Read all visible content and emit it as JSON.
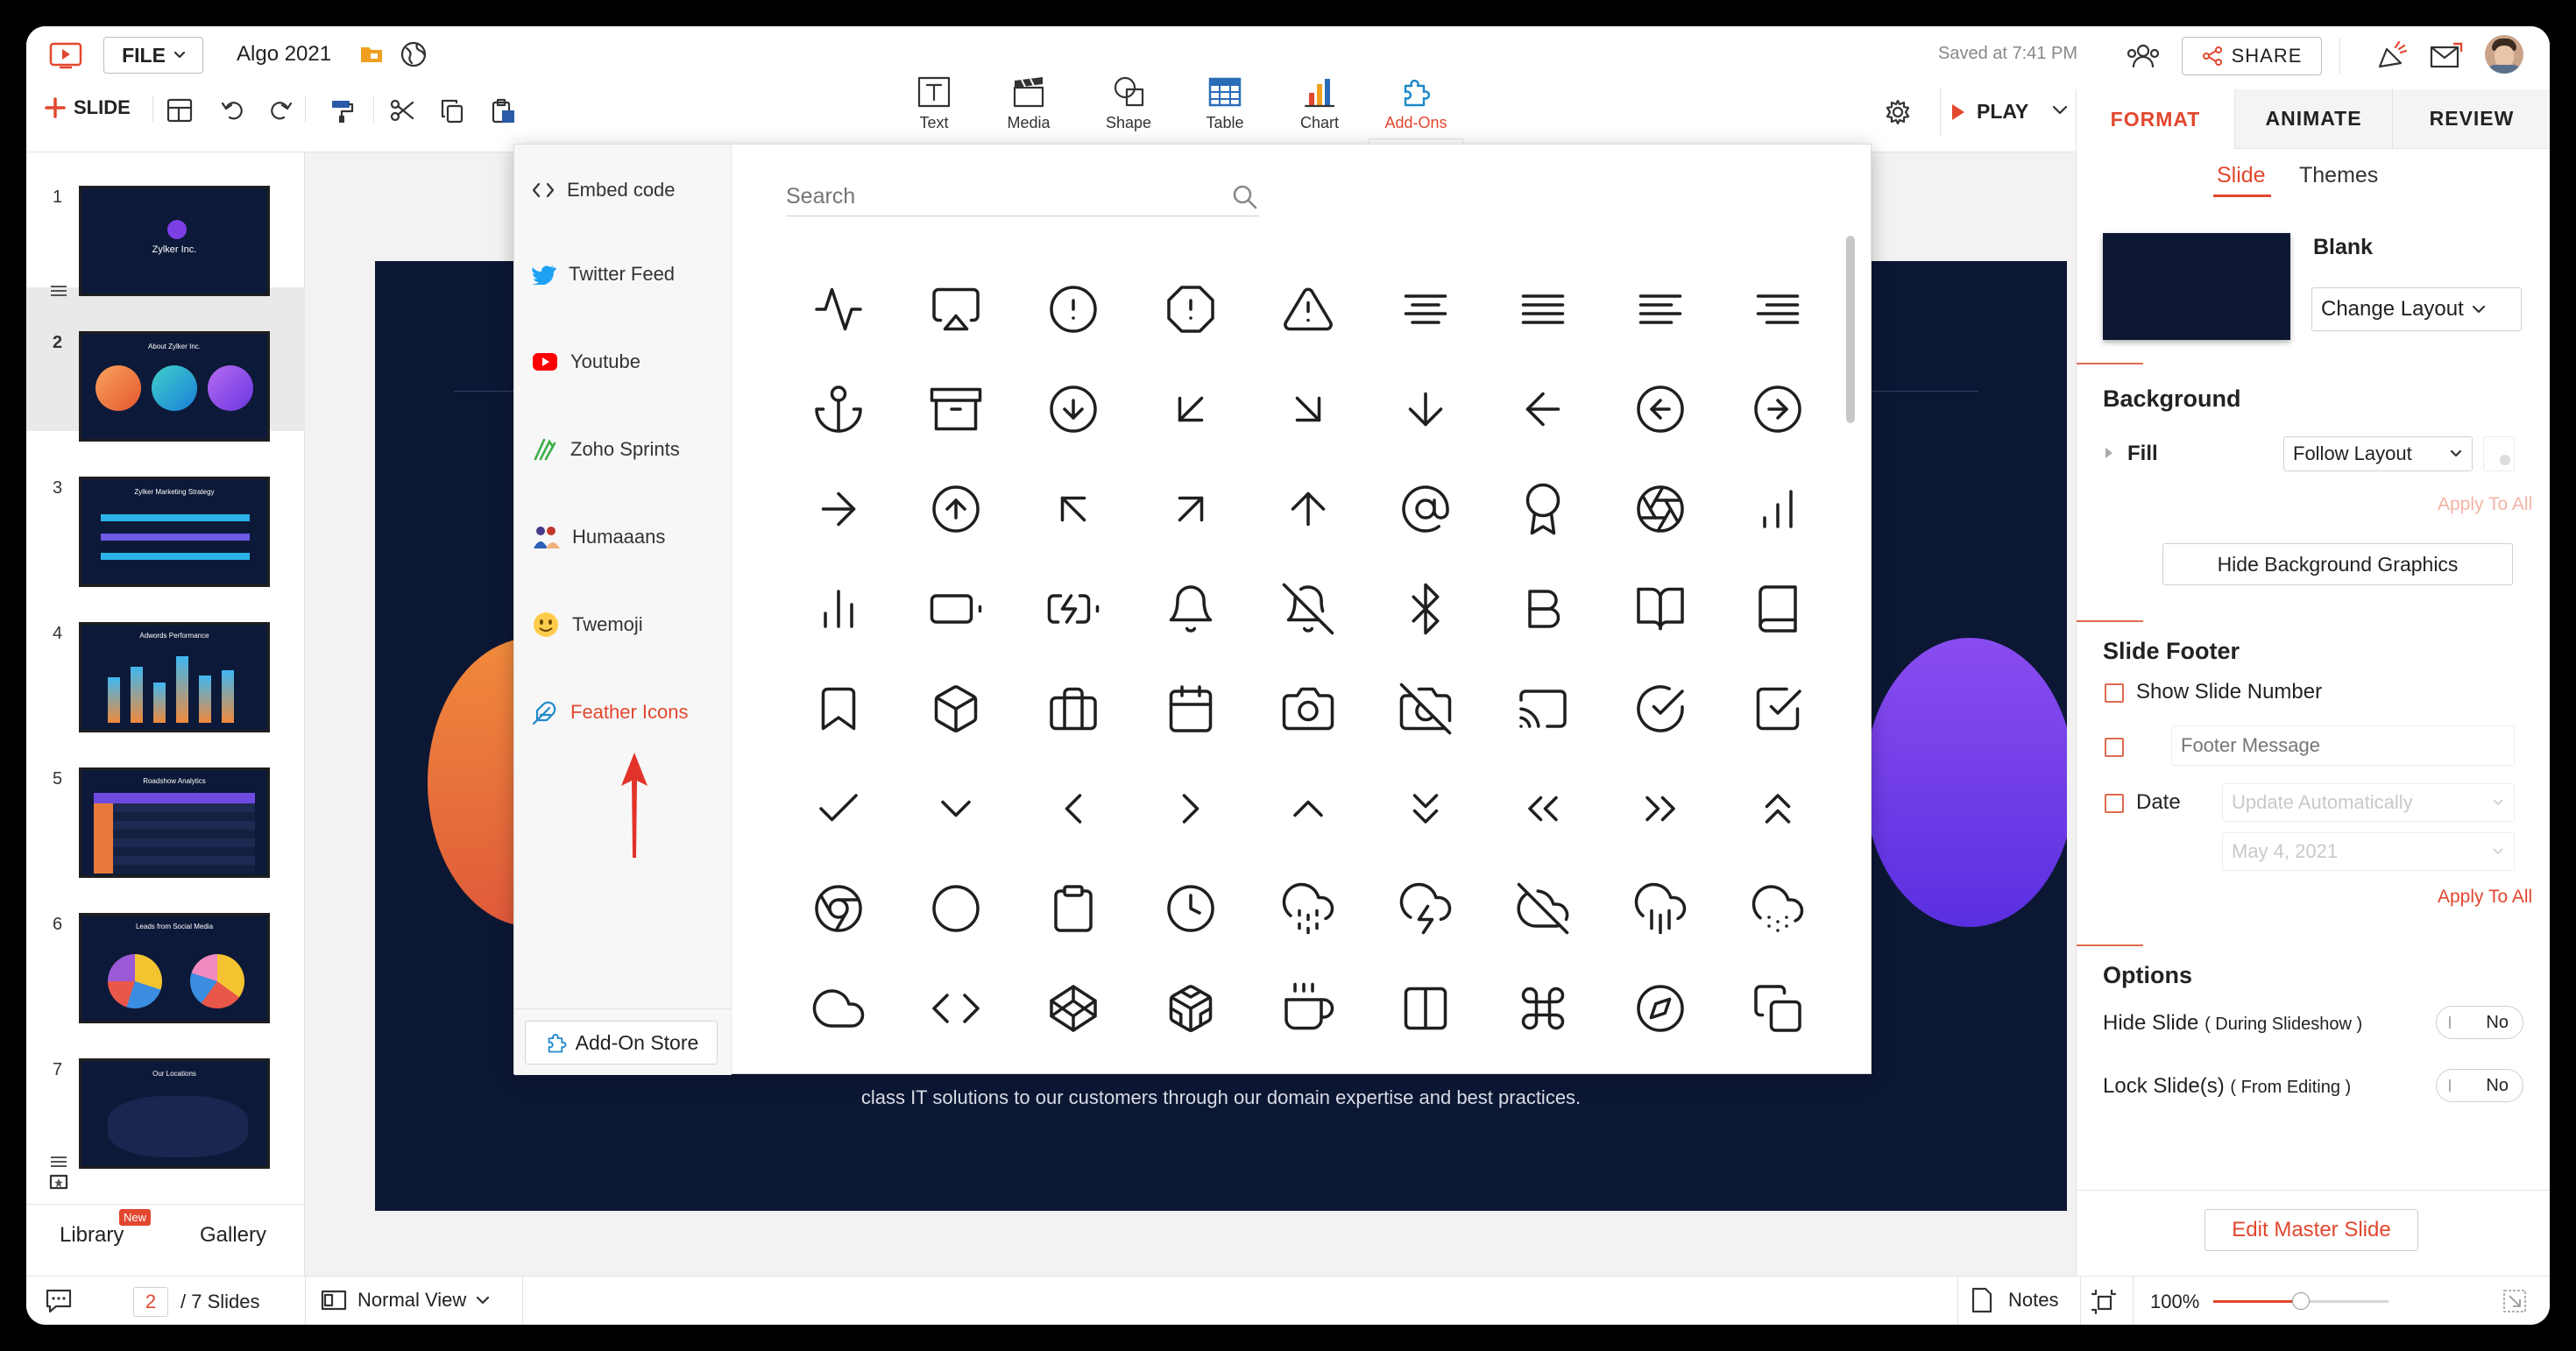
{
  "document": {
    "title": "Algo 2021",
    "saved_status": "Saved at 7:41 PM"
  },
  "toolbar": {
    "file_label": "FILE",
    "slide_label": "SLIDE",
    "share_label": "SHARE",
    "play_label": "PLAY",
    "insert_items": [
      {
        "label": "Text",
        "icon": "text-box-icon"
      },
      {
        "label": "Media",
        "icon": "clapper-icon"
      },
      {
        "label": "Shape",
        "icon": "shape-icon"
      },
      {
        "label": "Table",
        "icon": "table-icon"
      },
      {
        "label": "Chart",
        "icon": "bar-chart-icon"
      },
      {
        "label": "Add-Ons",
        "icon": "puzzle-icon",
        "active": true
      }
    ]
  },
  "right_panel": {
    "tabs": [
      "FORMAT",
      "ANIMATE",
      "REVIEW"
    ],
    "active_tab": "FORMAT",
    "subtabs": [
      "Slide",
      "Themes"
    ],
    "active_subtab": "Slide",
    "layout_name": "Blank",
    "change_layout_label": "Change Layout",
    "background": {
      "title": "Background",
      "fill_label": "Fill",
      "fill_value": "Follow Layout",
      "apply_all_label": "Apply To All",
      "hide_bg_label": "Hide Background Graphics"
    },
    "footer": {
      "title": "Slide Footer",
      "show_number_label": "Show Slide Number",
      "footer_message_placeholder": "Footer Message",
      "date_label": "Date",
      "date_mode": "Update Automatically",
      "date_value": "May 4, 2021",
      "apply_all_label": "Apply To All"
    },
    "options": {
      "title": "Options",
      "hide_slide_label": "Hide Slide",
      "hide_slide_note": "( During Slideshow )",
      "hide_slide_value": "No",
      "lock_slide_label": "Lock Slide(s)",
      "lock_slide_note": "( From Editing )",
      "lock_slide_value": "No"
    },
    "edit_master_label": "Edit Master Slide"
  },
  "slides_panel": {
    "slides": [
      {
        "number": "1",
        "title": "Zylker Inc."
      },
      {
        "number": "2",
        "title": "About Zylker Inc."
      },
      {
        "number": "3",
        "title": "Zylker Marketing Strategy"
      },
      {
        "number": "4",
        "title": "Adwords Performance"
      },
      {
        "number": "5",
        "title": "Roadshow Analytics"
      },
      {
        "number": "6",
        "title": "Leads from Social Media"
      },
      {
        "number": "7",
        "title": "Our Locations"
      }
    ],
    "selected": 2,
    "library_label": "Library",
    "library_badge": "New",
    "gallery_label": "Gallery"
  },
  "canvas": {
    "body_text": "class IT solutions to our customers through our domain expertise and best practices."
  },
  "addons_popup": {
    "menu": [
      {
        "label": "Embed code",
        "icon": "code-icon"
      },
      {
        "label": "Twitter Feed",
        "icon": "twitter-icon"
      },
      {
        "label": "Youtube",
        "icon": "youtube-icon"
      },
      {
        "label": "Zoho Sprints",
        "icon": "sprints-icon"
      },
      {
        "label": "Humaaans",
        "icon": "humaaans-icon"
      },
      {
        "label": "Twemoji",
        "icon": "emoji-icon"
      },
      {
        "label": "Feather Icons",
        "icon": "feather-icon",
        "active": true
      }
    ],
    "store_label": "Add-On Store",
    "search_placeholder": "Search",
    "icons": [
      "activity",
      "airplay",
      "alert-circle",
      "alert-octagon",
      "alert-triangle",
      "align-center",
      "align-justify",
      "align-left",
      "align-right",
      "anchor",
      "archive",
      "arrow-down-circle",
      "arrow-down-left",
      "arrow-down-right",
      "arrow-down",
      "arrow-left",
      "arrow-left-circle",
      "arrow-right-circle",
      "arrow-right",
      "arrow-up-circle",
      "arrow-up-left",
      "arrow-up-right",
      "arrow-up",
      "at-sign",
      "award",
      "aperture",
      "bar-chart",
      "bar-chart-2",
      "battery",
      "battery-charging",
      "bell",
      "bell-off",
      "bluetooth",
      "bold",
      "book-open",
      "book",
      "bookmark",
      "box",
      "briefcase",
      "calendar",
      "camera",
      "camera-off",
      "cast",
      "check-circle",
      "check-square",
      "check",
      "chevron-down",
      "chevron-left",
      "chevron-right",
      "chevron-up",
      "chevrons-down",
      "chevrons-left",
      "chevrons-right",
      "chevrons-up",
      "chrome",
      "circle",
      "clipboard",
      "clock",
      "cloud-drizzle",
      "cloud-lightning",
      "cloud-off",
      "cloud-rain",
      "cloud-snow",
      "cloud",
      "code",
      "codepen",
      "codesandbox",
      "coffee",
      "columns",
      "command",
      "compass",
      "copy"
    ]
  },
  "status_bar": {
    "current_page": "2",
    "total_pages": "/ 7 Slides",
    "view_label": "Normal View",
    "notes_label": "Notes",
    "zoom": "100%",
    "zoom_fraction": 0.5
  },
  "colors": {
    "accent": "#e2472f",
    "addon_blue": "#1e88c8",
    "slide_bg": "#0c1734"
  }
}
